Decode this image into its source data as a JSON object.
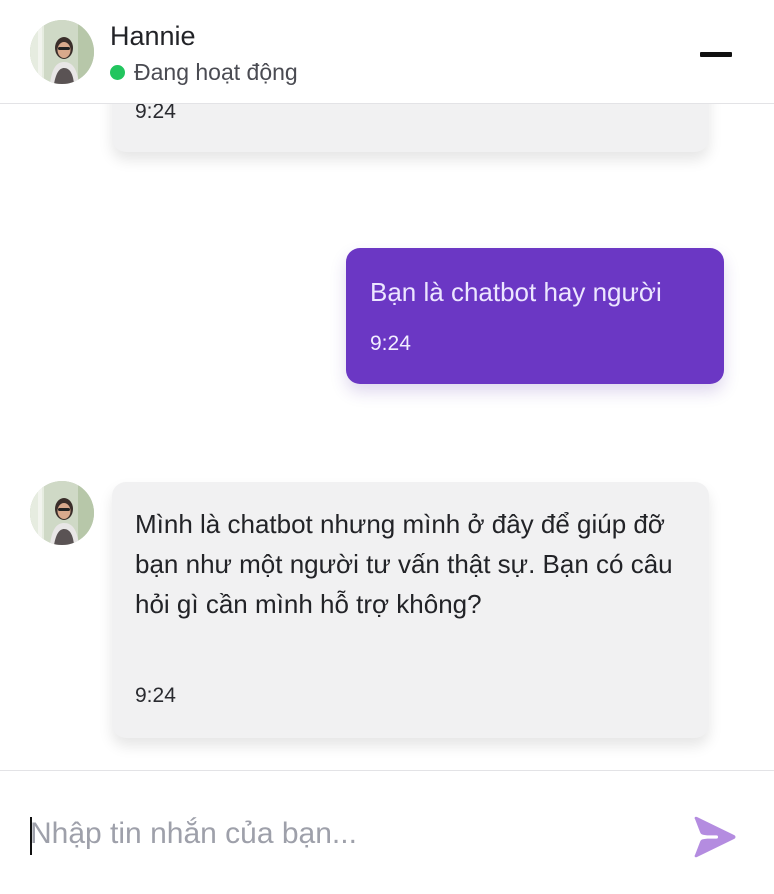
{
  "header": {
    "contact_name": "Hannie",
    "status_text": "Đang hoạt động",
    "status_color": "#22c55e",
    "avatar_icon": "avatar-photo",
    "minimize_icon": "minimize-icon"
  },
  "messages": [
    {
      "sender": "bot",
      "text": "",
      "time": "9:24"
    },
    {
      "sender": "user",
      "text": "Bạn là chatbot hay người",
      "time": "9:24"
    },
    {
      "sender": "bot",
      "text": "Mình là chatbot nhưng mình ở đây để giúp đỡ bạn như một người tư vấn thật sự. Bạn có câu hỏi gì cần mình hỗ trợ không?",
      "time": "9:24"
    }
  ],
  "composer": {
    "placeholder": "Nhập tin nhắn của bạn...",
    "value": "",
    "send_icon": "send-icon"
  },
  "colors": {
    "sent_bubble": "#6b37c4",
    "received_bubble": "#f1f1f2",
    "send_button": "#b48ce0"
  }
}
